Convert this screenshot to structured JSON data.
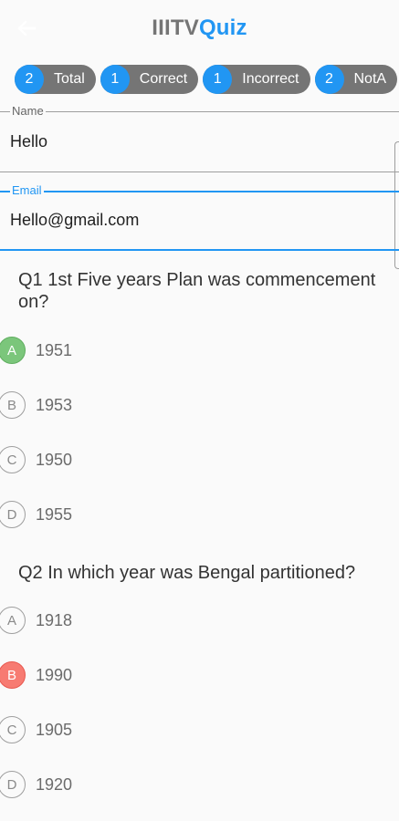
{
  "appbar": {
    "back_icon": "arrow-left-icon",
    "title_part1": "IIITV",
    "title_part2": "Quiz",
    "accent": "#2196f3",
    "title_grey": "#757575"
  },
  "stats": [
    {
      "count": "2",
      "label": "Total"
    },
    {
      "count": "1",
      "label": "Correct"
    },
    {
      "count": "1",
      "label": "Incorrect"
    },
    {
      "count": "2",
      "label": "NotA"
    }
  ],
  "form": {
    "name": {
      "label": "Name",
      "value": "Hello"
    },
    "email": {
      "label": "Email",
      "value": "Hello@gmail.com"
    }
  },
  "questions": [
    {
      "text": "Q1 1st Five years Plan was commencement on?",
      "options": [
        {
          "letter": "A",
          "text": "1951",
          "state": "correct"
        },
        {
          "letter": "B",
          "text": "1953",
          "state": "none"
        },
        {
          "letter": "C",
          "text": "1950",
          "state": "none"
        },
        {
          "letter": "D",
          "text": "1955",
          "state": "none"
        }
      ]
    },
    {
      "text": "Q2 In which year was Bengal partitioned?",
      "options": [
        {
          "letter": "A",
          "text": "1918",
          "state": "none"
        },
        {
          "letter": "B",
          "text": "1990",
          "state": "wrong"
        },
        {
          "letter": "C",
          "text": "1905",
          "state": "none"
        },
        {
          "letter": "D",
          "text": "1920",
          "state": "none"
        }
      ]
    }
  ],
  "colors": {
    "correct": "#7bc67b",
    "wrong": "#f77b72",
    "chip_bg": "#757575"
  }
}
